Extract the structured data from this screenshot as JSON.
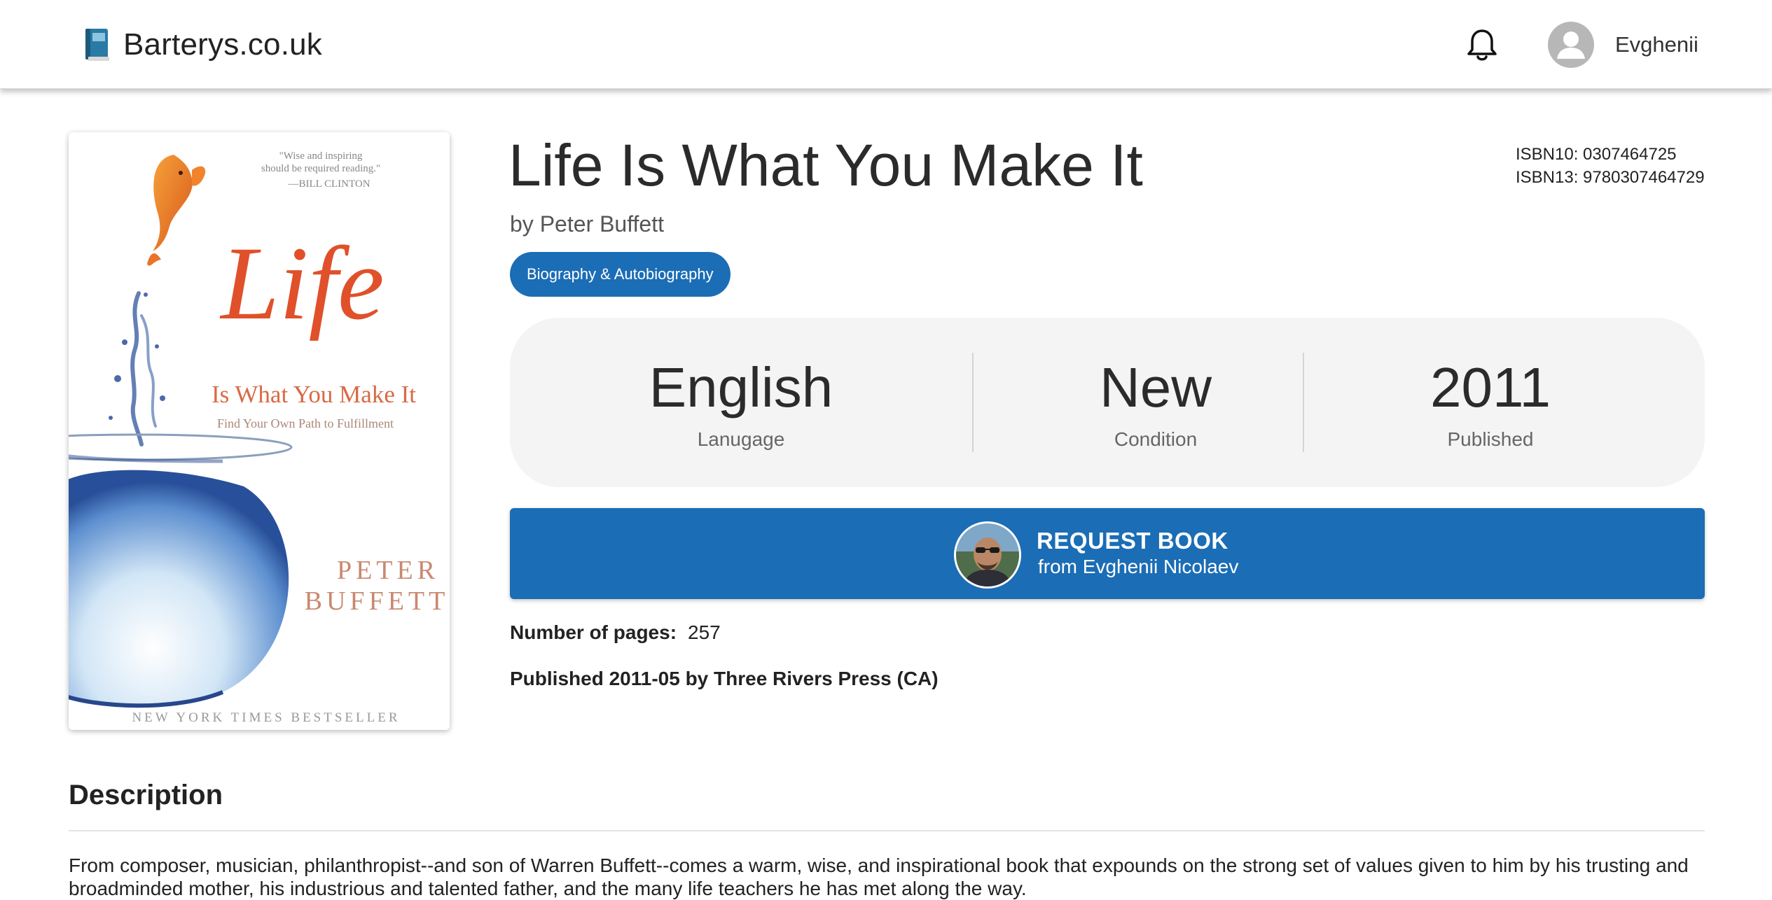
{
  "header": {
    "brand": "Barterys.co.uk",
    "logo_icon": "book-icon",
    "notification_icon": "bell-icon",
    "user": {
      "name": "Evghenii",
      "avatar_icon": "user-avatar-icon"
    }
  },
  "book": {
    "title": "Life Is What You Make It",
    "author": "by Peter Buffett",
    "genre": "Biography & Autobiography",
    "isbn10": "ISBN10: 0307464725",
    "isbn13": "ISBN13: 9780307464729",
    "cover": {
      "quote_line1": "\"Wise and inspiring",
      "quote_line2": "should be required reading.\"",
      "quote_attribution": "—BILL CLINTON",
      "title_big": "Life",
      "title_rest": "Is What You Make It",
      "subtitle": "Find Your Own Path to Fulfillment",
      "author_first": "PETER",
      "author_last": "BUFFETT",
      "banner": "NEW YORK TIMES BESTSELLER"
    },
    "stats": [
      {
        "value": "English",
        "label": "Lanugage"
      },
      {
        "value": "New",
        "label": "Condition"
      },
      {
        "value": "2011",
        "label": "Published"
      }
    ],
    "request": {
      "label": "REQUEST BOOK",
      "from": "from Evghenii Nicolaev"
    },
    "pages_label": "Number of pages:",
    "pages_value": "257",
    "published_line": "Published 2011-05 by Three Rivers Press (CA)"
  },
  "description": {
    "heading": "Description",
    "text": "From composer, musician, philanthropist--and son of Warren Buffett--comes a warm, wise, and inspirational book that expounds on the strong set of values given to him by his trusting and broadminded mother, his industrious and talented father, and the many life teachers he has met along the way."
  },
  "colors": {
    "accent": "#1b6db5",
    "stats_bg": "#f4f4f4",
    "cover_red": "#e0502a"
  }
}
